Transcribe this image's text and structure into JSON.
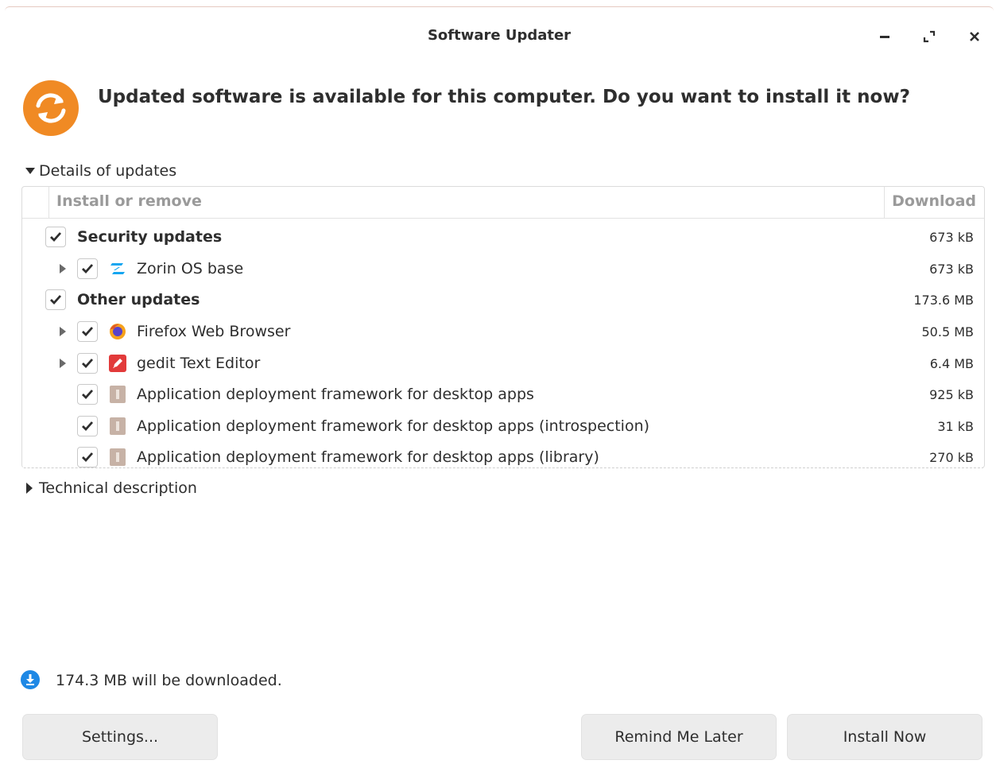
{
  "window": {
    "title": "Software Updater",
    "controls": [
      "minimize-icon",
      "maximize-icon",
      "close-icon"
    ]
  },
  "header": {
    "icon": "update-icon",
    "headline": "Updated software is available for this computer. Do you want to install it now?",
    "icon_color": "#f08a24"
  },
  "details_expander": {
    "label": "Details of updates",
    "expanded": true
  },
  "tree": {
    "columns": {
      "install": "Install or remove",
      "download": "Download"
    },
    "rows": [
      {
        "label": "Security updates",
        "size": "673 kB",
        "checked": true,
        "group": true
      },
      {
        "label": "Zorin OS base",
        "size": "673 kB",
        "checked": true,
        "icon": "zorin-icon",
        "expandable": true
      },
      {
        "label": "Other updates",
        "size": "173.6 MB",
        "checked": true,
        "group": true
      },
      {
        "label": "Firefox Web Browser",
        "size": "50.5 MB",
        "checked": true,
        "icon": "firefox-icon",
        "expandable": true
      },
      {
        "label": "gedit Text Editor",
        "size": "6.4 MB",
        "checked": true,
        "icon": "gedit-icon",
        "expandable": true
      },
      {
        "label": "Application deployment framework for desktop apps",
        "size": "925 kB",
        "checked": true,
        "icon": "package-icon"
      },
      {
        "label": "Application deployment framework for desktop apps (introspection)",
        "size": "31 kB",
        "checked": true,
        "icon": "package-icon"
      },
      {
        "label": "Application deployment framework for desktop apps (library)",
        "size": "270 kB",
        "checked": true,
        "icon": "package-icon"
      }
    ]
  },
  "technical_expander": {
    "label": "Technical description",
    "expanded": false
  },
  "status": {
    "icon": "download-info-icon",
    "text": "174.3 MB will be downloaded."
  },
  "buttons": {
    "settings": "Settings...",
    "remind": "Remind Me Later",
    "install": "Install Now"
  }
}
